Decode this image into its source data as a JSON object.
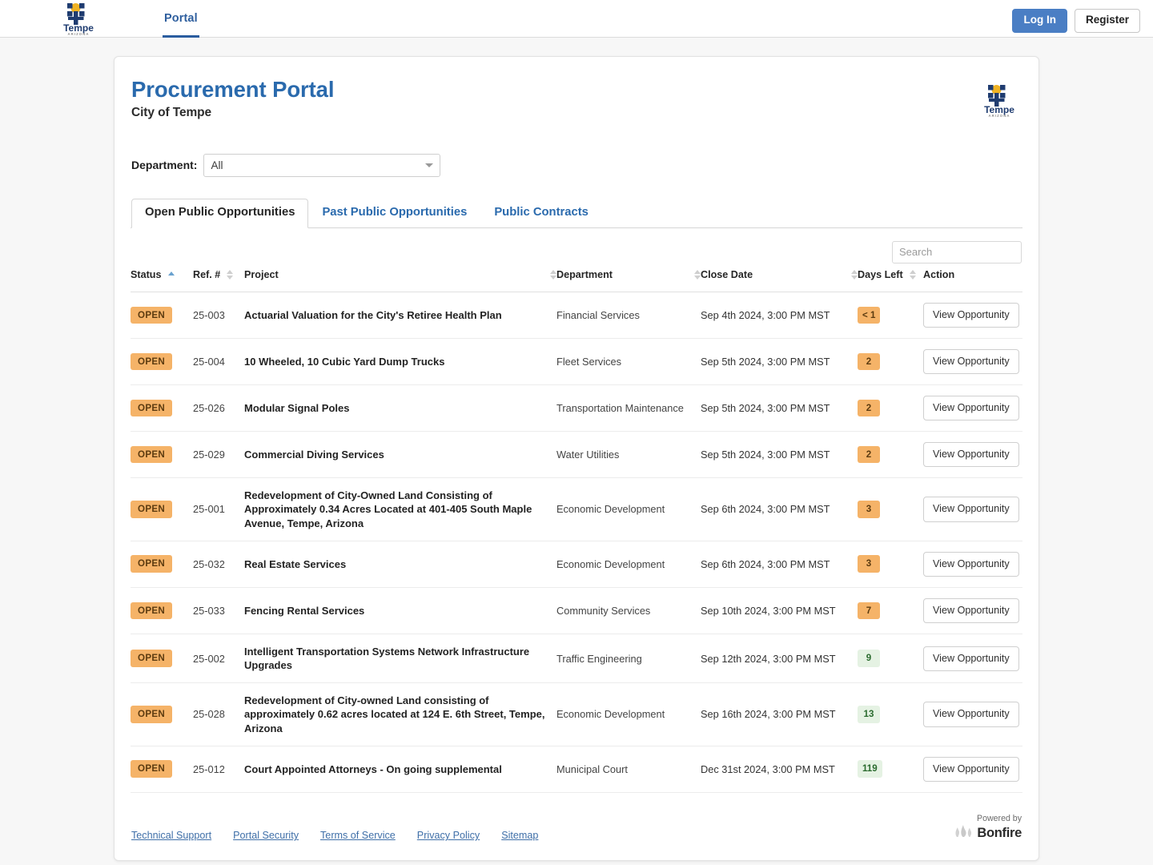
{
  "topnav": {
    "logo_name": "Tempe",
    "logo_sub": "ARIZONA",
    "links": [
      {
        "label": "Portal",
        "active": true
      }
    ],
    "login_label": "Log In",
    "register_label": "Register"
  },
  "card": {
    "title": "Procurement Portal",
    "subtitle": "City of Tempe",
    "logo_name": "Tempe",
    "logo_sub": "ARIZONA"
  },
  "filter": {
    "label": "Department:",
    "selected": "All",
    "options": [
      "All"
    ]
  },
  "tabs": [
    {
      "label": "Open Public Opportunities",
      "active": true
    },
    {
      "label": "Past Public Opportunities",
      "active": false
    },
    {
      "label": "Public Contracts",
      "active": false
    }
  ],
  "search": {
    "placeholder": "Search",
    "value": ""
  },
  "table": {
    "columns": [
      {
        "label": "Status",
        "sort": "asc"
      },
      {
        "label": "Ref. #",
        "sort": "none"
      },
      {
        "label": "Project",
        "sort": "none"
      },
      {
        "label": "Department",
        "sort": "none"
      },
      {
        "label": "Close Date",
        "sort": "none"
      },
      {
        "label": "Days Left",
        "sort": "none"
      },
      {
        "label": "Action",
        "sort": null
      }
    ],
    "action_label": "View Opportunity",
    "rows": [
      {
        "status": "OPEN",
        "ref": "25-003",
        "project": "Actuarial Valuation for the City's Retiree Health Plan",
        "department": "Financial Services",
        "close_date": "Sep 4th 2024, 3:00 PM MST",
        "days_left": "< 1",
        "days_state": "warn"
      },
      {
        "status": "OPEN",
        "ref": "25-004",
        "project": "10 Wheeled, 10 Cubic Yard Dump Trucks",
        "department": "Fleet Services",
        "close_date": "Sep 5th 2024, 3:00 PM MST",
        "days_left": "2",
        "days_state": "warn"
      },
      {
        "status": "OPEN",
        "ref": "25-026",
        "project": "Modular Signal Poles",
        "department": "Transportation Maintenance",
        "close_date": "Sep 5th 2024, 3:00 PM MST",
        "days_left": "2",
        "days_state": "warn"
      },
      {
        "status": "OPEN",
        "ref": "25-029",
        "project": "Commercial Diving Services",
        "department": "Water Utilities",
        "close_date": "Sep 5th 2024, 3:00 PM MST",
        "days_left": "2",
        "days_state": "warn"
      },
      {
        "status": "OPEN",
        "ref": "25-001",
        "project": "Redevelopment of City-Owned Land Consisting of Approximately 0.34 Acres Located at 401-405 South Maple Avenue, Tempe, Arizona",
        "department": "Economic Development",
        "close_date": "Sep 6th 2024, 3:00 PM MST",
        "days_left": "3",
        "days_state": "warn"
      },
      {
        "status": "OPEN",
        "ref": "25-032",
        "project": "Real Estate Services",
        "department": "Economic Development",
        "close_date": "Sep 6th 2024, 3:00 PM MST",
        "days_left": "3",
        "days_state": "warn"
      },
      {
        "status": "OPEN",
        "ref": "25-033",
        "project": "Fencing Rental Services",
        "department": "Community Services",
        "close_date": "Sep 10th 2024, 3:00 PM MST",
        "days_left": "7",
        "days_state": "warn"
      },
      {
        "status": "OPEN",
        "ref": "25-002",
        "project": "Intelligent Transportation Systems Network Infrastructure Upgrades",
        "department": "Traffic Engineering",
        "close_date": "Sep 12th 2024, 3:00 PM MST",
        "days_left": "9",
        "days_state": "ok"
      },
      {
        "status": "OPEN",
        "ref": "25-028",
        "project": "Redevelopment of City-owned Land consisting of approximately 0.62 acres located at 124 E. 6th Street, Tempe, Arizona",
        "department": "Economic Development",
        "close_date": "Sep 16th 2024, 3:00 PM MST",
        "days_left": "13",
        "days_state": "ok"
      },
      {
        "status": "OPEN",
        "ref": "25-012",
        "project": "Court Appointed Attorneys - On going supplemental",
        "department": "Municipal Court",
        "close_date": "Dec 31st 2024, 3:00 PM MST",
        "days_left": "119",
        "days_state": "ok"
      }
    ]
  },
  "footer": {
    "links": [
      "Technical Support",
      "Portal Security",
      "Terms of Service",
      "Privacy Policy",
      "Sitemap"
    ],
    "powered_by": "Powered by",
    "brand": "Bonfire"
  },
  "colors": {
    "accent_blue": "#2a6aad",
    "login_blue": "#4a7ec4",
    "badge_orange": "#f5b368",
    "badge_green_bg": "#e5f2e3",
    "badge_green_text": "#2b6b2f"
  }
}
